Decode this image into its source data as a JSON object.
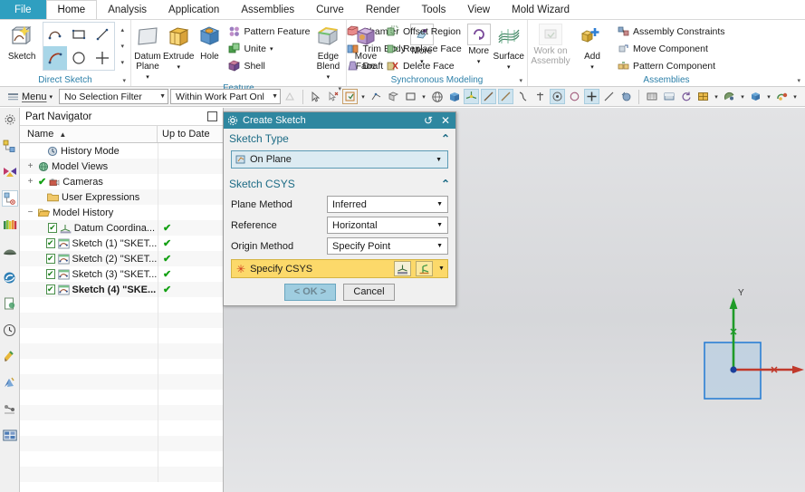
{
  "tabs": [
    {
      "label": "File",
      "state": "file"
    },
    {
      "label": "Home",
      "state": "active"
    },
    {
      "label": "Analysis",
      "state": "normal"
    },
    {
      "label": "Application",
      "state": "normal"
    },
    {
      "label": "Assemblies",
      "state": "normal"
    },
    {
      "label": "Curve",
      "state": "normal"
    },
    {
      "label": "Render",
      "state": "normal"
    },
    {
      "label": "Tools",
      "state": "normal"
    },
    {
      "label": "View",
      "state": "normal"
    },
    {
      "label": "Mold Wizard",
      "state": "normal"
    }
  ],
  "ribbon": {
    "groups": [
      {
        "title": "Direct Sketch",
        "sketch_label": "Sketch"
      },
      {
        "title": "Feature",
        "datum_label": "Datum",
        "datum_label2": "Plane",
        "extrude_label": "Extrude",
        "hole_label": "Hole",
        "pattern_feature": "Pattern Feature",
        "unite": "Unite",
        "shell": "Shell",
        "edge_label": "Edge",
        "edge_label2": "Blend",
        "chamfer": "Chamfer",
        "trim_body": "Trim Body",
        "draft": "Draft",
        "more": "More"
      },
      {
        "title": "Synchronous Modeling",
        "move_label": "Move",
        "move_label2": "Face",
        "offset_region": "Offset Region",
        "replace_face": "Replace Face",
        "delete_face": "Delete Face",
        "more": "More",
        "surface": "Surface"
      },
      {
        "title": "Assemblies",
        "work_on": "Work on",
        "work_on2": "Assembly",
        "add": "Add",
        "assembly_constraints": "Assembly Constraints",
        "move_component": "Move Component",
        "pattern_component": "Pattern Component"
      }
    ]
  },
  "toolstrip": {
    "menu_label": "Menu",
    "selection_filter": "No Selection Filter",
    "scope": "Within Work Part Onl"
  },
  "part_navigator": {
    "title": "Part Navigator",
    "col_name": "Name",
    "col_uptodate": "Up to Date",
    "rows": [
      {
        "label": "History Mode",
        "indent": 1,
        "twist": "",
        "checkbox": false,
        "check": false,
        "uptodate": "",
        "icon": "clock-icon",
        "bold": false
      },
      {
        "label": "Model Views",
        "indent": 0,
        "twist": "+",
        "checkbox": false,
        "check": false,
        "uptodate": "",
        "icon": "model-views-icon",
        "bold": false
      },
      {
        "label": "Cameras",
        "indent": 0,
        "twist": "+",
        "checkbox": false,
        "check": true,
        "uptodate": "",
        "icon": "camera-icon",
        "bold": false
      },
      {
        "label": "User Expressions",
        "indent": 1,
        "twist": "",
        "checkbox": false,
        "check": false,
        "uptodate": "",
        "icon": "folder-icon",
        "bold": false
      },
      {
        "label": "Model History",
        "indent": 0,
        "twist": "−",
        "checkbox": false,
        "check": false,
        "uptodate": "",
        "icon": "folder-open-icon",
        "bold": false
      },
      {
        "label": "Datum Coordina...",
        "indent": 2,
        "twist": "",
        "checkbox": true,
        "check": false,
        "uptodate": "✔",
        "icon": "datum-csys-icon",
        "bold": false
      },
      {
        "label": "Sketch (1) \"SKET...",
        "indent": 2,
        "twist": "",
        "checkbox": true,
        "check": false,
        "uptodate": "✔",
        "icon": "sketch-icon",
        "bold": false
      },
      {
        "label": "Sketch (2) \"SKET...",
        "indent": 2,
        "twist": "",
        "checkbox": true,
        "check": false,
        "uptodate": "✔",
        "icon": "sketch-icon",
        "bold": false
      },
      {
        "label": "Sketch (3) \"SKET...",
        "indent": 2,
        "twist": "",
        "checkbox": true,
        "check": false,
        "uptodate": "✔",
        "icon": "sketch-icon",
        "bold": false
      },
      {
        "label": "Sketch (4) \"SKE...",
        "indent": 2,
        "twist": "",
        "checkbox": true,
        "check": false,
        "uptodate": "✔",
        "icon": "sketch-icon",
        "bold": true
      }
    ],
    "empty_rows": 12
  },
  "dialog": {
    "title": "Create Sketch",
    "reset_icon": "reset-icon",
    "close_icon": "close-icon",
    "sketch_type_section": "Sketch Type",
    "sketch_type_value": "On Plane",
    "csys_section": "Sketch CSYS",
    "fields": [
      {
        "label": "Plane Method",
        "value": "Inferred"
      },
      {
        "label": "Reference",
        "value": "Horizontal"
      },
      {
        "label": "Origin Method",
        "value": "Specify Point"
      }
    ],
    "specify_csys": "Specify CSYS",
    "ok_label": "< OK >",
    "cancel_label": "Cancel"
  },
  "viewport": {
    "axis_x": "X",
    "axis_y": "Y",
    "colors": {
      "x_axis": "#c0392b",
      "y_axis": "#1f9b28",
      "plane_fill": "#b9cfe2",
      "plane_border": "#2b7fd4"
    }
  },
  "resource_bar": {
    "items": [
      "settings-icon",
      "assembly-navigator-icon",
      "constraint-navigator-icon",
      "part-navigator-icon",
      "layers-icon",
      "reuse-library-icon",
      "internet-explorer-icon",
      "history-palette-icon",
      "clock-history-icon",
      "system-materials-icon",
      "system-scenes-icon",
      "process-studio-icon",
      "roles-icon"
    ]
  },
  "theme": {
    "file_tab": "#2f9fc0",
    "dialog_title": "#2f87a0",
    "section_text": "#1c6b85",
    "group_title": "#2b7fa8",
    "highlight_row": "#fcd96a"
  }
}
